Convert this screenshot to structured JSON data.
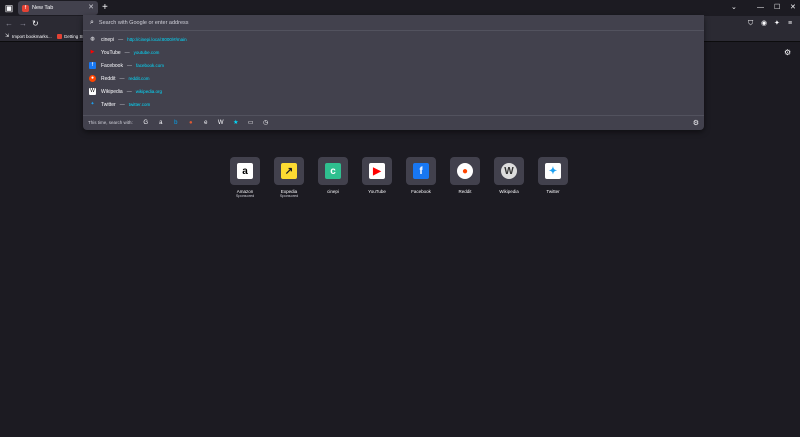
{
  "tabs": [
    {
      "label": "New Tab"
    }
  ],
  "bookmarks": [
    {
      "label": "Import bookmarks..."
    },
    {
      "label": "Getting Started"
    }
  ],
  "urlbar": {
    "placeholder": "Search with Google or enter address"
  },
  "suggestions": [
    {
      "title": "cinepi",
      "url": "http://cinepi.local:8000/#/main",
      "icon": "globe-icon",
      "color": "#42414d"
    },
    {
      "title": "YouTube",
      "url": "youtube.com",
      "icon": "youtube-icon",
      "color": "#ff0000"
    },
    {
      "title": "Facebook",
      "url": "facebook.com",
      "icon": "facebook-icon",
      "color": "#1877f2"
    },
    {
      "title": "Reddit",
      "url": "reddit.com",
      "icon": "reddit-icon",
      "color": "#ff4500"
    },
    {
      "title": "Wikipedia",
      "url": "wikipedia.org",
      "icon": "wikipedia-icon",
      "color": "#ffffff"
    },
    {
      "title": "Twitter",
      "url": "twitter.com",
      "icon": "twitter-icon",
      "color": "#1da1f2"
    }
  ],
  "engines": {
    "label": "This time, search with:"
  },
  "topsites": [
    {
      "name": "Amazon",
      "sponsored": "Sponsored",
      "icon": "amazon-icon"
    },
    {
      "name": "Expedia",
      "sponsored": "Sponsored",
      "icon": "expedia-icon"
    },
    {
      "name": "cinepi",
      "sponsored": "",
      "icon": "cinepi-icon"
    },
    {
      "name": "YouTube",
      "sponsored": "",
      "icon": "youtube-icon"
    },
    {
      "name": "Facebook",
      "sponsored": "",
      "icon": "facebook-icon"
    },
    {
      "name": "Reddit",
      "sponsored": "",
      "icon": "reddit-icon"
    },
    {
      "name": "Wikipedia",
      "sponsored": "",
      "icon": "wikipedia-icon"
    },
    {
      "name": "Twitter",
      "sponsored": "",
      "icon": "twitter-icon"
    }
  ],
  "colors": {
    "accent": "#00ddff",
    "background": "#1c1b22",
    "panel": "#42414d"
  }
}
